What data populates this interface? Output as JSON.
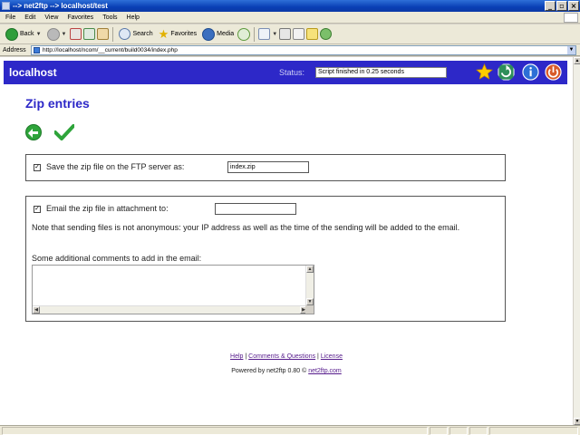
{
  "window": {
    "title": "--> net2ftp --> localhost/test",
    "controls": {
      "minimize": "_",
      "maximize": "▫",
      "close": "×"
    }
  },
  "menubar": {
    "items": [
      "File",
      "Edit",
      "View",
      "Favorites",
      "Tools",
      "Help"
    ]
  },
  "toolbar": {
    "back_label": "Back",
    "search_label": "Search",
    "favorites_label": "Favorites",
    "media_label": "Media"
  },
  "address": {
    "label": "Address",
    "url": "http://localhost/ncom/__current/build0034/index.php"
  },
  "app_header": {
    "site": "localhost",
    "status_label": "Status:",
    "status_value": "Script finished in 0.25 seconds",
    "icons": [
      "bookmark-star-icon",
      "refresh-icon",
      "info-icon",
      "logout-icon"
    ]
  },
  "page": {
    "title": "Zip entries",
    "save_option": {
      "checked": true,
      "label": "Save the zip file on the FTP server as:",
      "value": "index.zip"
    },
    "email_option": {
      "checked": true,
      "label": "Email the zip file in attachment to:",
      "value": "",
      "note": "Note that sending files is not anonymous: your IP address as well as the time of the sending will be added to the email.",
      "comments_label": "Some additional comments to add in the email:",
      "comments_value": ""
    }
  },
  "footer": {
    "help": "Help",
    "separator": "|",
    "comments": "Comments & Questions",
    "license": "License",
    "powered_prefix": "Powered by net2ftp 0.80 ©",
    "powered_link": "net2ftp.com"
  },
  "colors": {
    "header_bg": "#2d28c8",
    "title_color": "#2d28c8"
  }
}
